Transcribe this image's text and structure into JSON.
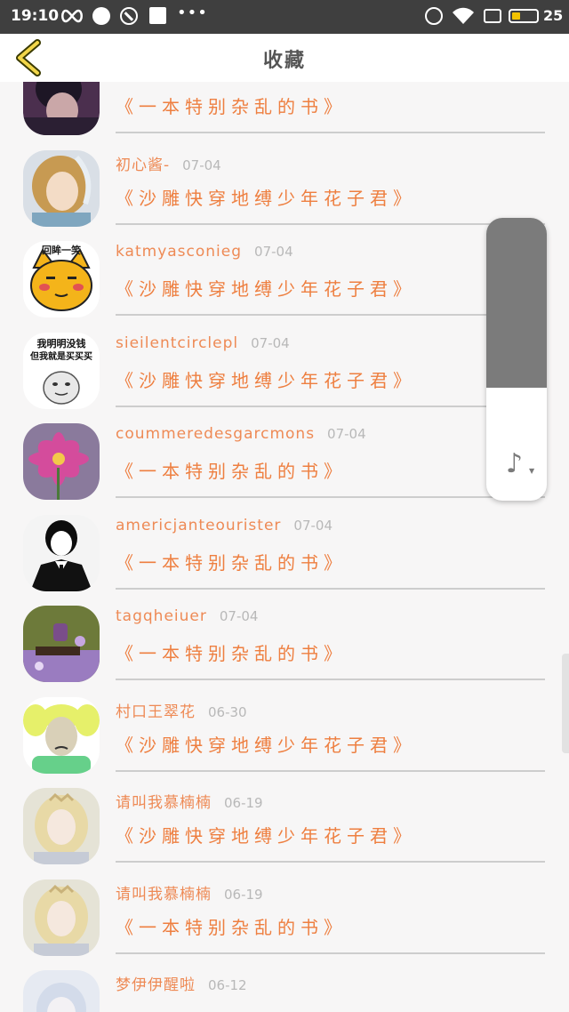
{
  "status_bar": {
    "time": "19:10",
    "more": "•••",
    "battery": "25"
  },
  "header": {
    "title": "收藏"
  },
  "favorites": [
    {
      "name": "",
      "date": "",
      "book": "《一本特别杂乱的书》",
      "avatar": "dark-hair-man"
    },
    {
      "name": "初心酱-",
      "date": "07-04",
      "book": "《沙雕快穿地缚少年花子君》",
      "avatar": "anime-girl-blonde"
    },
    {
      "name": "katmyasconieg",
      "date": "07-04",
      "book": "《沙雕快穿地缚少年花子君》",
      "avatar": "yellow-cat-sticker"
    },
    {
      "name": "sieilentcirclepl",
      "date": "07-04",
      "book": "《沙雕快穿地缚少年花子君》",
      "avatar": "meme-text"
    },
    {
      "name": "coummeredesgarcmons",
      "date": "07-04",
      "book": "《一本特别杂乱的书》",
      "avatar": "pink-flower"
    },
    {
      "name": "americjanteourister",
      "date": "07-04",
      "book": "《一本特别杂乱的书》",
      "avatar": "bw-suit-man"
    },
    {
      "name": "tagqheiuer",
      "date": "07-04",
      "book": "《一本特别杂乱的书》",
      "avatar": "purple-flowers"
    },
    {
      "name": "村口王翠花",
      "date": "06-30",
      "book": "《沙雕快穿地缚少年花子君》",
      "avatar": "pigtails-meme"
    },
    {
      "name": "请叫我慕楠楠",
      "date": "06-19",
      "book": "《沙雕快穿地缚少年花子君》",
      "avatar": "princess-blonde"
    },
    {
      "name": "请叫我慕楠楠",
      "date": "06-19",
      "book": "《一本特别杂乱的书》",
      "avatar": "princess-blonde"
    },
    {
      "name": "梦伊伊醒啦",
      "date": "06-12",
      "book": "",
      "avatar": "anime-pale"
    }
  ],
  "avatar_meme_text": [
    "回眸一笑",
    "我明明没钱",
    "但我就是买买买"
  ],
  "music_widget": {
    "icon": "music-note-icon",
    "level": 0.6
  },
  "colors": {
    "accent": "#ee7f40",
    "status_bar": "#3f3f3f",
    "muted": "#b8b8b8"
  }
}
